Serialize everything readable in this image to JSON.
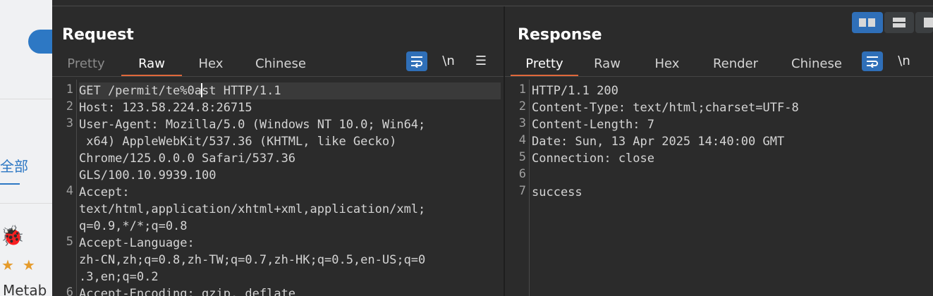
{
  "background_app": {
    "tab_text": "全部",
    "title_text": "Metab",
    "stars": "★★"
  },
  "request": {
    "title": "Request",
    "tabs": [
      {
        "label": "Pretty",
        "state": "disabled"
      },
      {
        "label": "Raw",
        "state": "active"
      },
      {
        "label": "Hex",
        "state": "normal"
      },
      {
        "label": "Chinese",
        "state": "normal"
      }
    ],
    "newline_toggle": "\\n",
    "lines": [
      {
        "number": "1",
        "text_before_caret": "GET /permit/te%0a",
        "text_after_caret": "st HTTP/1.1"
      },
      {
        "number": "2",
        "text": [
          "Host: 123.58.224.8:26715"
        ]
      },
      {
        "number": "3",
        "text": [
          "User-Agent: Mozilla/5.0 (Windows NT 10.0; Win64;",
          " x64) AppleWebKit/537.36 (KHTML, like Gecko)",
          "Chrome/125.0.0.0 Safari/537.36",
          "GLS/100.10.9939.100"
        ]
      },
      {
        "number": "4",
        "text": [
          "Accept:",
          "text/html,application/xhtml+xml,application/xml;",
          "q=0.9,*/*;q=0.8"
        ]
      },
      {
        "number": "5",
        "text": [
          "Accept-Language:",
          "zh-CN,zh;q=0.8,zh-TW;q=0.7,zh-HK;q=0.5,en-US;q=0",
          ".3,en;q=0.2"
        ]
      },
      {
        "number": "6",
        "text": [
          "Accept-Encoding: gzip, deflate"
        ]
      }
    ]
  },
  "response": {
    "title": "Response",
    "tabs": [
      {
        "label": "Pretty",
        "state": "active"
      },
      {
        "label": "Raw",
        "state": "normal"
      },
      {
        "label": "Hex",
        "state": "normal"
      },
      {
        "label": "Render",
        "state": "normal"
      },
      {
        "label": "Chinese",
        "state": "normal"
      }
    ],
    "newline_toggle": "\\n",
    "lines": [
      {
        "number": "1",
        "text": [
          "HTTP/1.1 200"
        ]
      },
      {
        "number": "2",
        "text": [
          "Content-Type: text/html;charset=UTF-8"
        ]
      },
      {
        "number": "3",
        "text": [
          "Content-Length: 7"
        ]
      },
      {
        "number": "4",
        "text": [
          "Date: Sun, 13 Apr 2025 14:40:00 GMT"
        ]
      },
      {
        "number": "5",
        "text": [
          "Connection: close"
        ]
      },
      {
        "number": "6",
        "text": [
          ""
        ]
      },
      {
        "number": "7",
        "text": [
          "success"
        ]
      }
    ]
  },
  "colors": {
    "accent_blue": "#2f6fb8",
    "active_tab_underline": "#e0683b",
    "panel_background": "#2b2b2b"
  },
  "icons": [
    "wrap-lines-icon",
    "menu-icon",
    "layout-side-by-side-icon",
    "layout-stacked-icon",
    "layout-tabs-icon",
    "bug-icon"
  ]
}
